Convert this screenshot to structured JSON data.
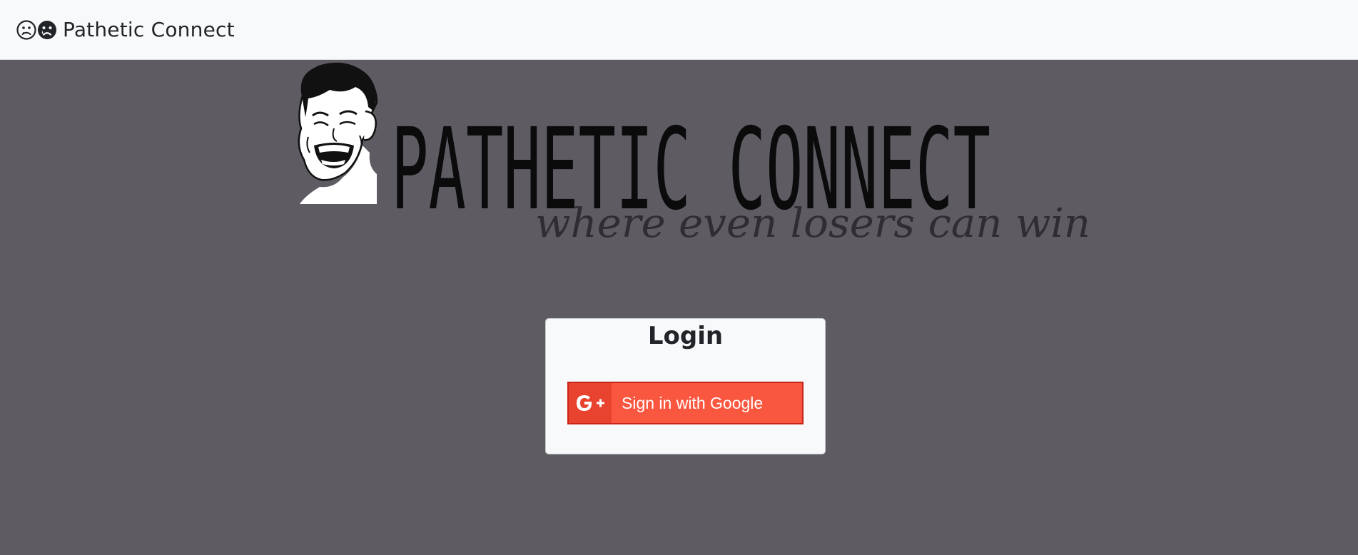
{
  "navbar": {
    "brand_icons": [
      "sad-face-outline-icon",
      "crying-face-solid-icon"
    ],
    "brand_text": "Pathetic Connect"
  },
  "banner": {
    "title": "PATHETIC CONNECT",
    "tagline": "where even losers can win",
    "mascot": "laughing-meme-face-image"
  },
  "login": {
    "title": "Login",
    "google_button_label": "Sign in with Google",
    "google_icon": "google-plus-icon"
  },
  "colors": {
    "page_background": "#5e5b63",
    "navbar_background": "#f8f9fa",
    "google_red": "#fa5740",
    "google_red_dark": "#e8432f"
  }
}
